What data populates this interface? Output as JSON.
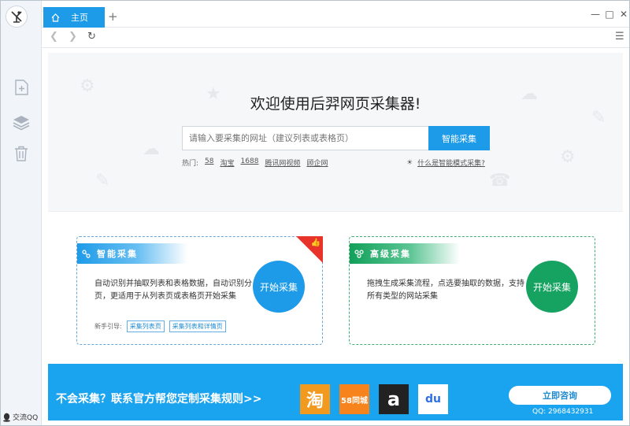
{
  "colors": {
    "accent": "#1e9be8",
    "green": "#16a361",
    "red_corner": "#e8332a",
    "banner": "#1aa3ee"
  },
  "rail": {
    "logo": "logo-icon",
    "items": [
      "new-task-icon",
      "layers-icon",
      "trash-icon"
    ],
    "qq_label": "交流QQ"
  },
  "tabs": [
    {
      "label": "主页",
      "icon": "home-icon"
    }
  ],
  "hero": {
    "title": "欢迎使用后羿网页采集器!",
    "input_placeholder": "请输入要采集的网址（建议列表或表格页）",
    "smart_button": "智能采集",
    "hot_label": "热门:",
    "hot_links": [
      "58",
      "淘宝",
      "1688",
      "腾讯网视频",
      "顾企网"
    ],
    "help_link": "什么是智能模式采集?"
  },
  "cards": {
    "smart": {
      "title": "智能采集",
      "desc": "自动识别并抽取列表和表格数据，自动识别分页，更适用于从列表页或表格页开始采集",
      "cta": "开始采集",
      "guide_label": "新手引导:",
      "guides": [
        "采集列表页",
        "采集列表和详情页"
      ]
    },
    "advanced": {
      "title": "高级采集",
      "desc": "拖拽生成采集流程，点选要抽取的数据，支持所有类型的网站采集",
      "cta": "开始采集"
    }
  },
  "banner": {
    "text": "不会采集？联系官方帮您定制采集规则>>",
    "brands": [
      {
        "label": "淘",
        "icon": "taobao-logo"
      },
      {
        "label": "58同城",
        "icon": "58-logo"
      },
      {
        "label": "a",
        "icon": "amazon-logo"
      },
      {
        "label": "du",
        "icon": "baidu-logo"
      }
    ],
    "consult_button": "立即咨询",
    "qq": "QQ: 2968432931"
  }
}
